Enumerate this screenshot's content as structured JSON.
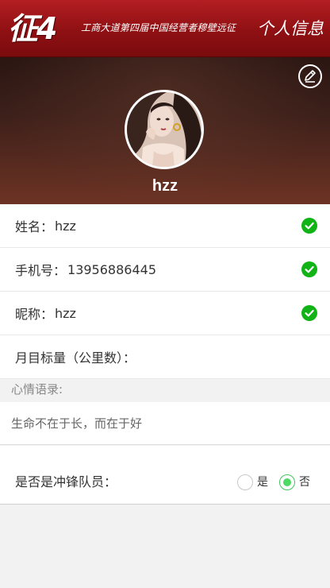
{
  "header": {
    "logo_text": "征4",
    "slogan": "工商大道第四届中国经营者穆壁远征",
    "title": "个人信息"
  },
  "profile": {
    "username": "hzz"
  },
  "fields": [
    {
      "label": "姓名：",
      "value": "hzz",
      "verified": true
    },
    {
      "label": "手机号：",
      "value": "13956886445",
      "verified": true
    },
    {
      "label": "昵称：",
      "value": "hzz",
      "verified": true
    },
    {
      "label": "月目标量（公里数）：",
      "value": "",
      "verified": false
    }
  ],
  "mood": {
    "header": "心情语录:",
    "text": "生命不在于长，而在于好"
  },
  "member": {
    "label": "是否是冲锋队员：",
    "options": [
      {
        "label": "是",
        "checked": false
      },
      {
        "label": "否",
        "checked": true
      }
    ]
  },
  "colors": {
    "header_red": "#9c1518",
    "check_green": "#11b316",
    "radio_green": "#4cd964"
  }
}
